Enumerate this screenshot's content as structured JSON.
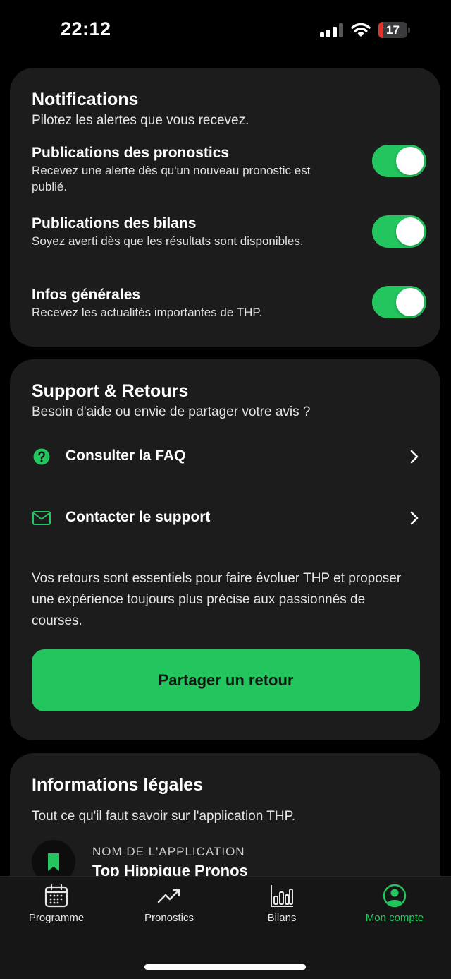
{
  "status_bar": {
    "time": "22:12",
    "battery_level": "17",
    "battery_color": "#e5322d"
  },
  "theme": {
    "accent": "#22c55e",
    "card_bg": "#1c1c1c",
    "background": "#000000"
  },
  "notifications": {
    "title": "Notifications",
    "subtitle": "Pilotez les alertes que vous recevez.",
    "items": [
      {
        "title": "Publications des pronostics",
        "description": "Recevez une alerte dès qu'un nouveau pronostic est publié.",
        "enabled": true
      },
      {
        "title": "Publications des bilans",
        "description": "Soyez averti dès que les résultats sont disponibles.",
        "enabled": true
      },
      {
        "title": "Infos générales",
        "description": "Recevez les actualités importantes de THP.",
        "enabled": true
      }
    ]
  },
  "support": {
    "title": "Support & Retours",
    "subtitle": "Besoin d'aide ou envie de partager votre avis ?",
    "items": [
      {
        "label": "Consulter la FAQ",
        "icon": "question-circle-icon"
      },
      {
        "label": "Contacter le support",
        "icon": "mail-icon"
      }
    ],
    "text": "Vos retours sont essentiels pour faire évoluer THP et proposer une expérience toujours plus précise aux passionnés de courses.",
    "cta_label": "Partager un retour"
  },
  "legal": {
    "title": "Informations légales",
    "subtitle": "Tout ce qu'il faut savoir sur l'application THP.",
    "app_name_label": "NOM DE L'APPLICATION",
    "app_name_value": "Top Hippique Pronos",
    "icon": "bookmark-icon"
  },
  "tabbar": {
    "tabs": [
      {
        "label": "Programme",
        "icon": "calendar-icon",
        "active": false
      },
      {
        "label": "Pronostics",
        "icon": "trending-up-icon",
        "active": false
      },
      {
        "label": "Bilans",
        "icon": "bar-chart-icon",
        "active": false
      },
      {
        "label": "Mon compte",
        "icon": "user-circle-icon",
        "active": true
      }
    ]
  }
}
